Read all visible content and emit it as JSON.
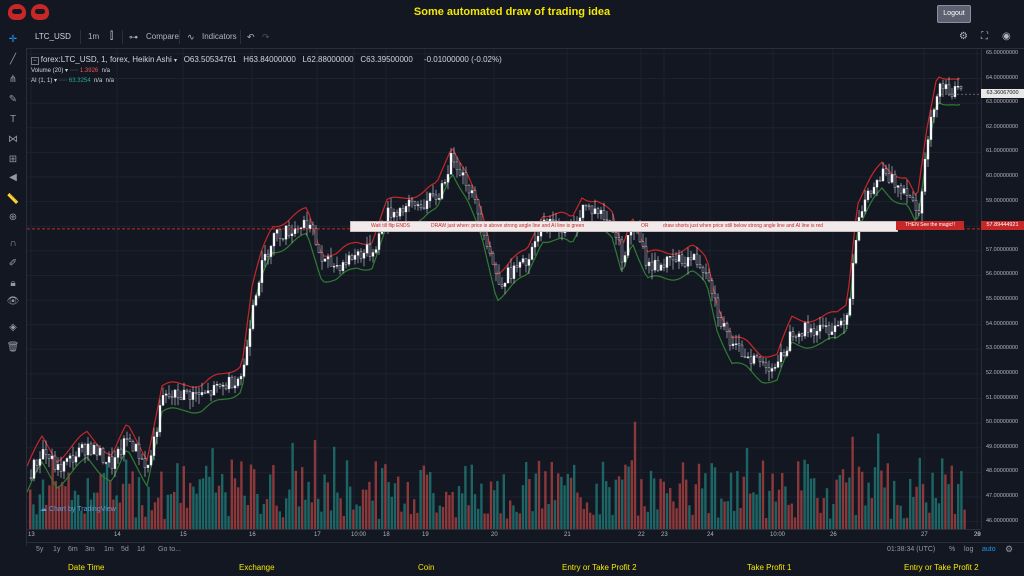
{
  "app": {
    "title": "Some automated draw of trading idea",
    "logout": "Logout"
  },
  "toolbar": {
    "symbol": "LTC_USD",
    "interval": "1m",
    "compare": "Compare",
    "indicators": "Indicators"
  },
  "legend": {
    "main": "forex:LTC_USD, 1, forex, Heikin Ashi",
    "open": "O63.50534761",
    "high": "H63.84000000",
    "low": "L62.88000000",
    "close": "C63.39500000",
    "change": "-0.01000000 (-0.02%)",
    "volume_label": "Volume (20)",
    "volume_value": "1.3926",
    "volume_na": "n/a",
    "ai_label": "AI (1, 1)",
    "ai_value": "63.3254",
    "ai_na1": "n/a",
    "ai_na2": "n/a"
  },
  "annotation": {
    "part1": "Wait till flip ENDS",
    "part2": "DRAW just when: price is above strong angle line and AI line is green",
    "part3": "OR",
    "part4": "draw shorts just when price still below strong angle line and AI line is red",
    "cta": "THEN See the magic!!"
  },
  "price_tags": {
    "current": "63.36067000",
    "line": "57.89444921"
  },
  "price_axis": [
    "65.00000000",
    "64.00000000",
    "63.00000000",
    "62.00000000",
    "61.00000000",
    "60.00000000",
    "59.00000000",
    "58.00000000",
    "57.00000000",
    "56.00000000",
    "55.00000000",
    "54.00000000",
    "53.00000000",
    "52.00000000",
    "51.00000000",
    "50.00000000",
    "49.00000000",
    "48.00000000",
    "47.00000000",
    "46.00000000"
  ],
  "time_axis": [
    "13",
    "14",
    "15",
    "16",
    "17",
    "10:00",
    "18",
    "19",
    "20",
    "21",
    "22",
    "23",
    "24",
    "10:00",
    "26",
    "27",
    "28",
    "29"
  ],
  "bottombar": {
    "ranges": [
      "5y",
      "1y",
      "6m",
      "3m",
      "1m",
      "5d",
      "1d"
    ],
    "goto": "Go to...",
    "clock": "01:38:34 (UTC)",
    "percent": "%",
    "log": "log",
    "auto": "auto"
  },
  "watermark": "Chart by TradingView",
  "footer": [
    "Date Time",
    "Exchange",
    "Coin",
    "Entry or Take Profit 2",
    "Take Profit 1",
    "Entry or Take Profit 2"
  ],
  "chart_data": {
    "type": "candlestick",
    "ylim": [
      45.7,
      65.2
    ],
    "price_key": [
      [
        0,
        47.8
      ],
      [
        15,
        48.9
      ],
      [
        30,
        48.1
      ],
      [
        45,
        48.6
      ],
      [
        60,
        49.1
      ],
      [
        72,
        48.7
      ],
      [
        85,
        48.3
      ],
      [
        100,
        49.4
      ],
      [
        120,
        48.2
      ],
      [
        135,
        51.0
      ],
      [
        160,
        51.2
      ],
      [
        175,
        51.1
      ],
      [
        195,
        51.5
      ],
      [
        215,
        52.0
      ],
      [
        225,
        55.0
      ],
      [
        235,
        56.5
      ],
      [
        245,
        57.6
      ],
      [
        260,
        57.8
      ],
      [
        280,
        58.2
      ],
      [
        295,
        56.5
      ],
      [
        310,
        56.4
      ],
      [
        330,
        56.9
      ],
      [
        345,
        57.0
      ],
      [
        360,
        58.5
      ],
      [
        380,
        58.8
      ],
      [
        395,
        58.9
      ],
      [
        410,
        59.2
      ],
      [
        425,
        60.9
      ],
      [
        440,
        59.7
      ],
      [
        455,
        58.0
      ],
      [
        470,
        55.7
      ],
      [
        485,
        56.2
      ],
      [
        500,
        56.5
      ],
      [
        515,
        58.1
      ],
      [
        535,
        58.0
      ],
      [
        545,
        57.8
      ],
      [
        555,
        58.8
      ],
      [
        570,
        58.6
      ],
      [
        585,
        58.0
      ],
      [
        595,
        56.7
      ],
      [
        605,
        58.1
      ],
      [
        620,
        56.4
      ],
      [
        640,
        56.5
      ],
      [
        665,
        56.7
      ],
      [
        680,
        56.2
      ],
      [
        690,
        54.5
      ],
      [
        705,
        53.0
      ],
      [
        720,
        52.8
      ],
      [
        735,
        52.4
      ],
      [
        750,
        52.3
      ],
      [
        765,
        53.8
      ],
      [
        780,
        53.8
      ],
      [
        795,
        53.8
      ],
      [
        810,
        54.0
      ],
      [
        820,
        54.5
      ],
      [
        830,
        58.5
      ],
      [
        845,
        59.5
      ],
      [
        855,
        60.1
      ],
      [
        865,
        59.8
      ],
      [
        880,
        59.5
      ],
      [
        890,
        58.5
      ],
      [
        900,
        61.5
      ],
      [
        910,
        63.8
      ],
      [
        930,
        63.4
      ]
    ],
    "bands": [
      [
        "green",
        "#2e7d32",
        -0.6,
        0
      ],
      [
        "red",
        "#c62828",
        0.5,
        90
      ]
    ],
    "volume_max_height": 120,
    "colors": {
      "up": "#26a69a",
      "down": "#ef5350",
      "candle_up": "#ffffff",
      "candle_down": "#1e2130"
    }
  }
}
